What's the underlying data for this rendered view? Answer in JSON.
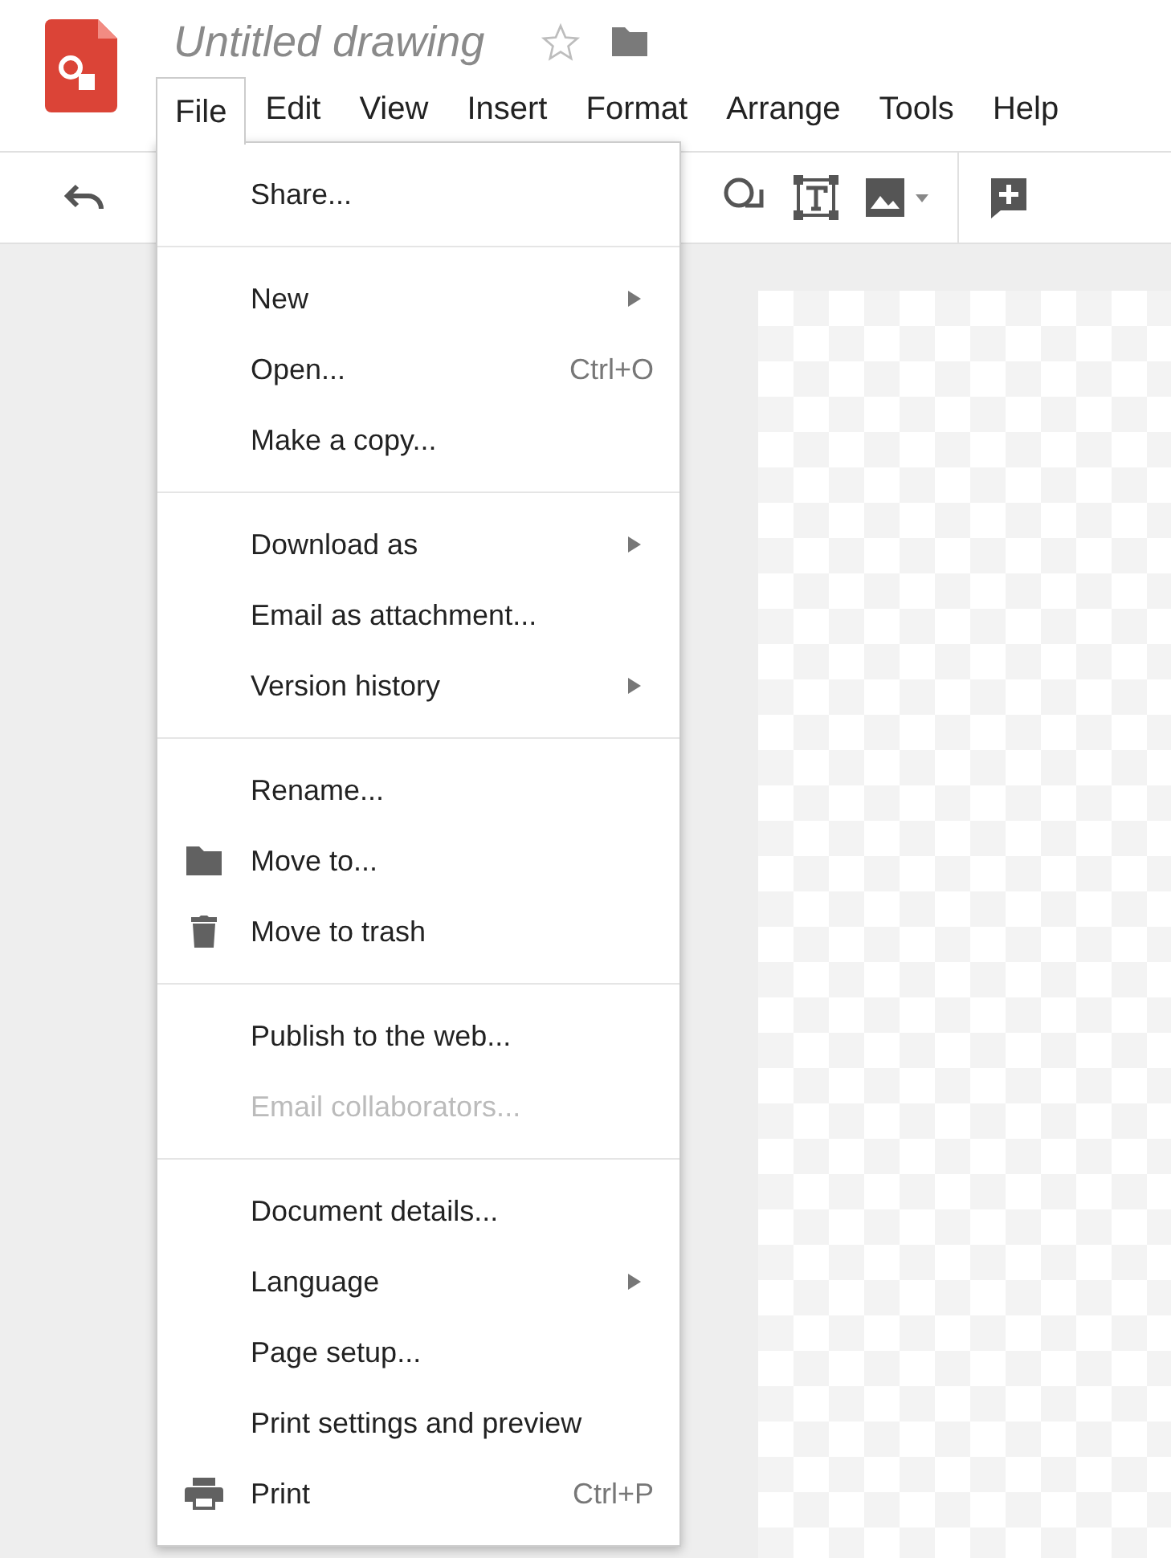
{
  "document": {
    "title": "Untitled drawing"
  },
  "menubar": [
    {
      "label": "File",
      "selected": true
    },
    {
      "label": "Edit",
      "selected": false
    },
    {
      "label": "View",
      "selected": false
    },
    {
      "label": "Insert",
      "selected": false
    },
    {
      "label": "Format",
      "selected": false
    },
    {
      "label": "Arrange",
      "selected": false
    },
    {
      "label": "Tools",
      "selected": false
    },
    {
      "label": "Help",
      "selected": false
    }
  ],
  "file_menu": {
    "sections": [
      {
        "items": [
          {
            "label": "Share...",
            "submenu": false,
            "disabled": false
          }
        ]
      },
      {
        "items": [
          {
            "label": "New",
            "submenu": true,
            "disabled": false
          },
          {
            "label": "Open...",
            "shortcut": "Ctrl+O",
            "submenu": false,
            "disabled": false
          },
          {
            "label": "Make a copy...",
            "submenu": false,
            "disabled": false
          }
        ]
      },
      {
        "items": [
          {
            "label": "Download as",
            "submenu": true,
            "disabled": false
          },
          {
            "label": "Email as attachment...",
            "submenu": false,
            "disabled": false
          },
          {
            "label": "Version history",
            "submenu": true,
            "disabled": false
          }
        ]
      },
      {
        "items": [
          {
            "label": "Rename...",
            "submenu": false,
            "disabled": false
          },
          {
            "label": "Move to...",
            "kind": "folder",
            "submenu": false,
            "disabled": false
          },
          {
            "label": "Move to trash",
            "kind": "trash",
            "submenu": false,
            "disabled": false
          }
        ]
      },
      {
        "items": [
          {
            "label": "Publish to the web...",
            "submenu": false,
            "disabled": false
          },
          {
            "label": "Email collaborators...",
            "submenu": false,
            "disabled": true
          }
        ]
      },
      {
        "items": [
          {
            "label": "Document details...",
            "submenu": false,
            "disabled": false
          },
          {
            "label": "Language",
            "submenu": true,
            "disabled": false
          },
          {
            "label": "Page setup...",
            "submenu": false,
            "disabled": false
          },
          {
            "label": "Print settings and preview",
            "submenu": false,
            "disabled": false
          },
          {
            "label": "Print",
            "kind": "print",
            "shortcut": "Ctrl+P",
            "submenu": false,
            "disabled": false
          }
        ]
      }
    ]
  }
}
